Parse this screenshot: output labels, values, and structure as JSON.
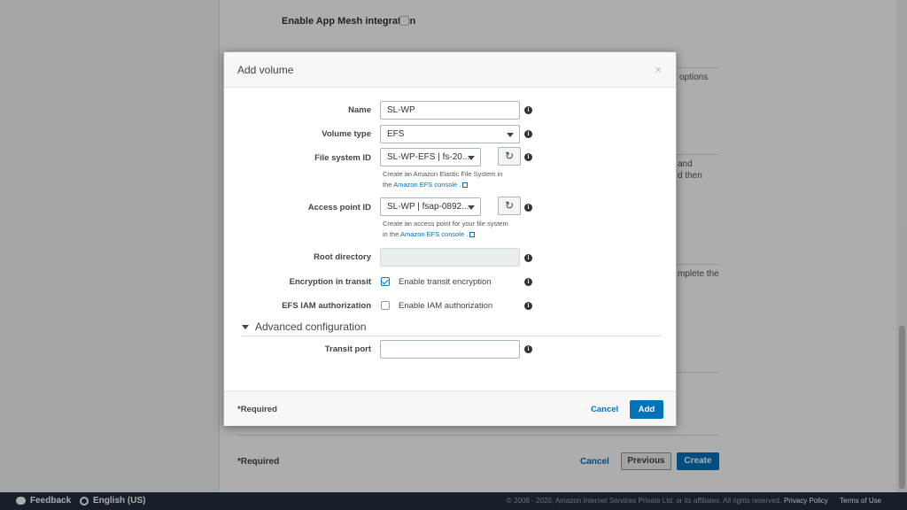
{
  "background": {
    "app_mesh_label": "Enable App Mesh integration",
    "snippets": [
      "options",
      "and",
      "d then",
      "mplete the"
    ],
    "footer_required": "*Required",
    "cancel_label": "Cancel",
    "previous_label": "Previous",
    "create_label": "Create"
  },
  "footer": {
    "feedback": "Feedback",
    "language": "English (US)",
    "copyright": "© 2008 - 2020, Amazon Internet Services Private Ltd. or its affiliates. All rights reserved.",
    "privacy": "Privacy Policy",
    "terms": "Terms of Use"
  },
  "modal": {
    "title": "Add volume",
    "close": "×",
    "fields": {
      "name": {
        "label": "Name",
        "value": "SL-WP"
      },
      "volume_type": {
        "label": "Volume type",
        "value": "EFS"
      },
      "file_system_id": {
        "label": "File system ID",
        "value": "SL-WP-EFS | fs-20...",
        "help_line1": "Create an Amazon Elastic File System in",
        "help_prefix": "the",
        "help_link": "Amazon EFS console ."
      },
      "access_point_id": {
        "label": "Access point ID",
        "value": "SL-WP | fsap-0892...",
        "help_line1": "Create an access point for your file system",
        "help_prefix": "in the",
        "help_link": "Amazon EFS console ."
      },
      "root_directory": {
        "label": "Root directory",
        "value": ""
      },
      "encryption": {
        "label": "Encryption in transit",
        "checkbox_label": "Enable transit encryption",
        "checked": true
      },
      "iam": {
        "label": "EFS IAM authorization",
        "checkbox_label": "Enable IAM authorization",
        "checked": false
      },
      "transit_port": {
        "label": "Transit port",
        "value": ""
      }
    },
    "advanced_label": "Advanced configuration",
    "required_note": "*Required",
    "cancel_label": "Cancel",
    "add_label": "Add"
  }
}
